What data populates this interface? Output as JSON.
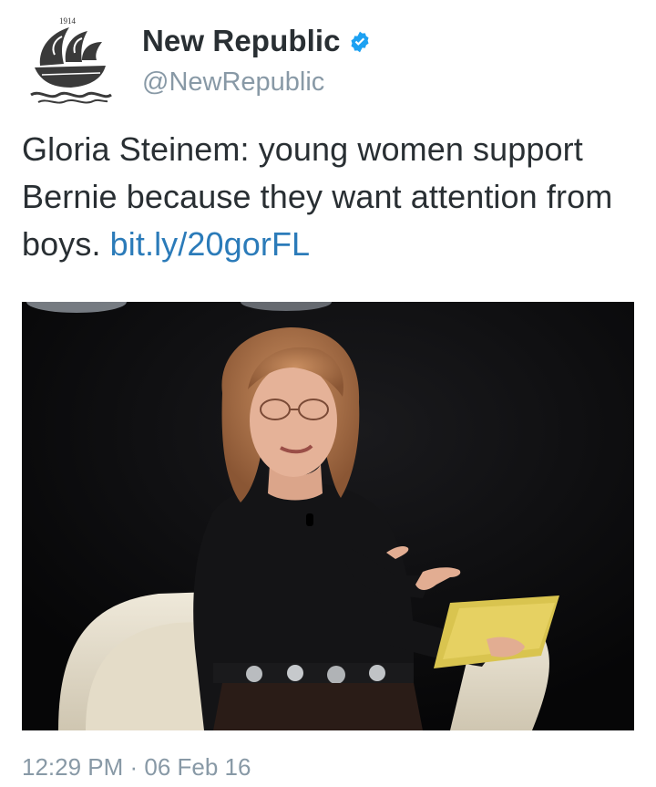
{
  "account": {
    "name": "New Republic",
    "handle": "@NewRepublic",
    "verified": true,
    "avatar_icon": "ship-logo-icon",
    "avatar_year": "1914"
  },
  "tweet": {
    "text": "Gloria Steinem: young women support Bernie because they want attention from boys.",
    "link": "bit.ly/20gorFL",
    "timestamp": "12:29 PM · 06 Feb 16"
  },
  "colors": {
    "link": "#2b7bb9",
    "verified_badge": "#1da1f2",
    "secondary_text": "#8899a6",
    "primary_text": "#292f33"
  }
}
